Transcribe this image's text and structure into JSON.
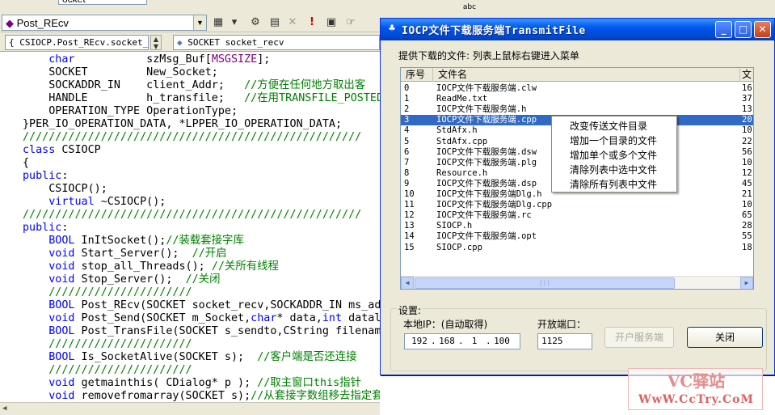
{
  "ide": {
    "top_combo": "Post_REcv",
    "top_combo_prev": "ocket",
    "class_combo": "CSIOCP.Post_REcv.socket_r",
    "member_combo": "SOCKET socket_recv",
    "tb_icons": {
      "abc": "abc",
      "exclaim": "!",
      "hand": "☞"
    },
    "code_lines": [
      [
        {
          "t": "    "
        },
        {
          "t": "char",
          "c": "kw"
        },
        {
          "t": "           szMsg_Buf["
        },
        {
          "t": "MSGSIZE",
          "c": "mac"
        },
        {
          "t": "];"
        }
      ],
      [
        {
          "t": "    SOCKET         New_Socket;"
        }
      ],
      [
        {
          "t": "    SOCKADDR_IN    client_Addr;   "
        },
        {
          "t": "//方便在任何地方取出客",
          "c": "cm"
        }
      ],
      [
        {
          "t": "    HANDLE         h_transfile;   "
        },
        {
          "t": "//在用TRANSFILE_POSTED",
          "c": "cm"
        }
      ],
      [
        {
          "t": "    OPERATION_TYPE OperationType;"
        }
      ],
      [
        {
          "t": "}PER_IO_OPERATION_DATA, *LPPER_IO_OPERATION_DATA;"
        }
      ],
      [
        {
          "t": "////////////////////////////////////////////////////",
          "c": "cm"
        }
      ],
      [
        {
          "t": "class",
          "c": "kw"
        },
        {
          "t": " CSIOCP"
        }
      ],
      [
        {
          "t": "{"
        }
      ],
      [
        {
          "t": "public",
          "c": "kw"
        },
        {
          "t": ":"
        }
      ],
      [
        {
          "t": "    CSIOCP();"
        }
      ],
      [
        {
          "t": "    "
        },
        {
          "t": "virtual",
          "c": "kw"
        },
        {
          "t": " ~CSIOCP();"
        }
      ],
      [
        {
          "t": "////////////////////////////////////////////////////",
          "c": "cm"
        }
      ],
      [
        {
          "t": "public",
          "c": "kw"
        },
        {
          "t": ":"
        }
      ],
      [
        {
          "t": "    "
        },
        {
          "t": "BOOL",
          "c": "kw"
        },
        {
          "t": " InItSocket();"
        },
        {
          "t": "//装载套接字库",
          "c": "cm"
        }
      ],
      [
        {
          "t": "    "
        },
        {
          "t": "void",
          "c": "kw"
        },
        {
          "t": " Start_Server();  "
        },
        {
          "t": "//开启",
          "c": "cm"
        }
      ],
      [
        {
          "t": "    "
        },
        {
          "t": "void",
          "c": "kw"
        },
        {
          "t": " stop_all_Threads(); "
        },
        {
          "t": "//关所有线程",
          "c": "cm"
        }
      ],
      [
        {
          "t": "    "
        },
        {
          "t": "void",
          "c": "kw"
        },
        {
          "t": " Stop_Server();  "
        },
        {
          "t": "//关闭",
          "c": "cm"
        }
      ],
      [
        {
          "t": "    //////////////////////",
          "c": "cm"
        }
      ],
      [
        {
          "t": "    "
        },
        {
          "t": "BOOL",
          "c": "kw"
        },
        {
          "t": " Post_REcv(SOCKET socket_recv,SOCKADDR_IN ms_add"
        }
      ],
      [
        {
          "t": "    "
        },
        {
          "t": "void",
          "c": "kw"
        },
        {
          "t": " Post_Send(SOCKET m_Socket,"
        },
        {
          "t": "char",
          "c": "kw"
        },
        {
          "t": "* data,"
        },
        {
          "t": "int",
          "c": "kw"
        },
        {
          "t": " datale"
        }
      ],
      [
        {
          "t": "    "
        },
        {
          "t": "BOOL",
          "c": "kw"
        },
        {
          "t": " Post_TransFile(SOCKET s_sendto,CString filenam"
        }
      ],
      [
        {
          "t": "    //////////////////////",
          "c": "cm"
        }
      ],
      [
        {
          "t": "    "
        },
        {
          "t": "BOOL",
          "c": "kw"
        },
        {
          "t": " Is_SocketAlive(SOCKET s);  "
        },
        {
          "t": "//客户端是否还连接",
          "c": "cm"
        }
      ],
      [
        {
          "t": "    //////////////////////",
          "c": "cm"
        }
      ],
      [
        {
          "t": "    "
        },
        {
          "t": "void",
          "c": "kw"
        },
        {
          "t": " getmainthis( CDialog* p ); "
        },
        {
          "t": "//取主窗口this指针",
          "c": "cm"
        }
      ],
      [
        {
          "t": "    "
        },
        {
          "t": "void",
          "c": "kw"
        },
        {
          "t": " removefromarray(SOCKET s);"
        },
        {
          "t": "//从套接字数组移去指定套接字",
          "c": "cm"
        }
      ]
    ]
  },
  "dialog": {
    "title": "IOCP文件下载服务端TransmitFile",
    "list_label": "提供下载的文件: 列表上鼠标右键进入菜单",
    "columns": [
      "序号",
      "文件名",
      "文"
    ],
    "files": [
      {
        "idx": "0",
        "name": "IOCP文件下载服务端.clw",
        "size": "16"
      },
      {
        "idx": "1",
        "name": "ReadMe.txt",
        "size": "37"
      },
      {
        "idx": "2",
        "name": "IOCP文件下载服务端.h",
        "size": "13"
      },
      {
        "idx": "3",
        "name": "IOCP文件下载服务端.cpp",
        "size": "20"
      },
      {
        "idx": "4",
        "name": "StdAfx.h",
        "size": "10"
      },
      {
        "idx": "5",
        "name": "StdAfx.cpp",
        "size": "22"
      },
      {
        "idx": "6",
        "name": "IOCP文件下载服务端.dsw",
        "size": "56"
      },
      {
        "idx": "7",
        "name": "IOCP文件下载服务端.plg",
        "size": "10"
      },
      {
        "idx": "8",
        "name": "Resource.h",
        "size": "12"
      },
      {
        "idx": "9",
        "name": "IOCP文件下载服务端.dsp",
        "size": "45"
      },
      {
        "idx": "10",
        "name": "IOCP文件下载服务端Dlg.h",
        "size": "21"
      },
      {
        "idx": "11",
        "name": "IOCP文件下载服务端Dlg.cpp",
        "size": "10"
      },
      {
        "idx": "12",
        "name": "IOCP文件下载服务端.rc",
        "size": "65"
      },
      {
        "idx": "13",
        "name": "SIOCP.h",
        "size": "28"
      },
      {
        "idx": "14",
        "name": "IOCP文件下载服务端.opt",
        "size": "55"
      },
      {
        "idx": "15",
        "name": "SIOCP.cpp",
        "size": "18"
      }
    ],
    "selected_index": 3,
    "context_menu": [
      "改变传送文件目录",
      "增加一个目录的文件",
      "增加单个或多个文件",
      "清除列表中选中文件",
      "清除所有列表中文件"
    ],
    "settings_label": "设置:",
    "ip_label": "本地IP：(自动取得)",
    "ip": [
      "192",
      "168",
      "1",
      "100"
    ],
    "port_label": "开放端口：",
    "port": "1125",
    "start_btn": "开户服务端",
    "close_btn": "关闭",
    "caption_min": "_",
    "caption_max": "□",
    "caption_close": "✕"
  },
  "watermark": {
    "logo": "VC驿站",
    "url": "WwW.CcTry.CoM"
  }
}
